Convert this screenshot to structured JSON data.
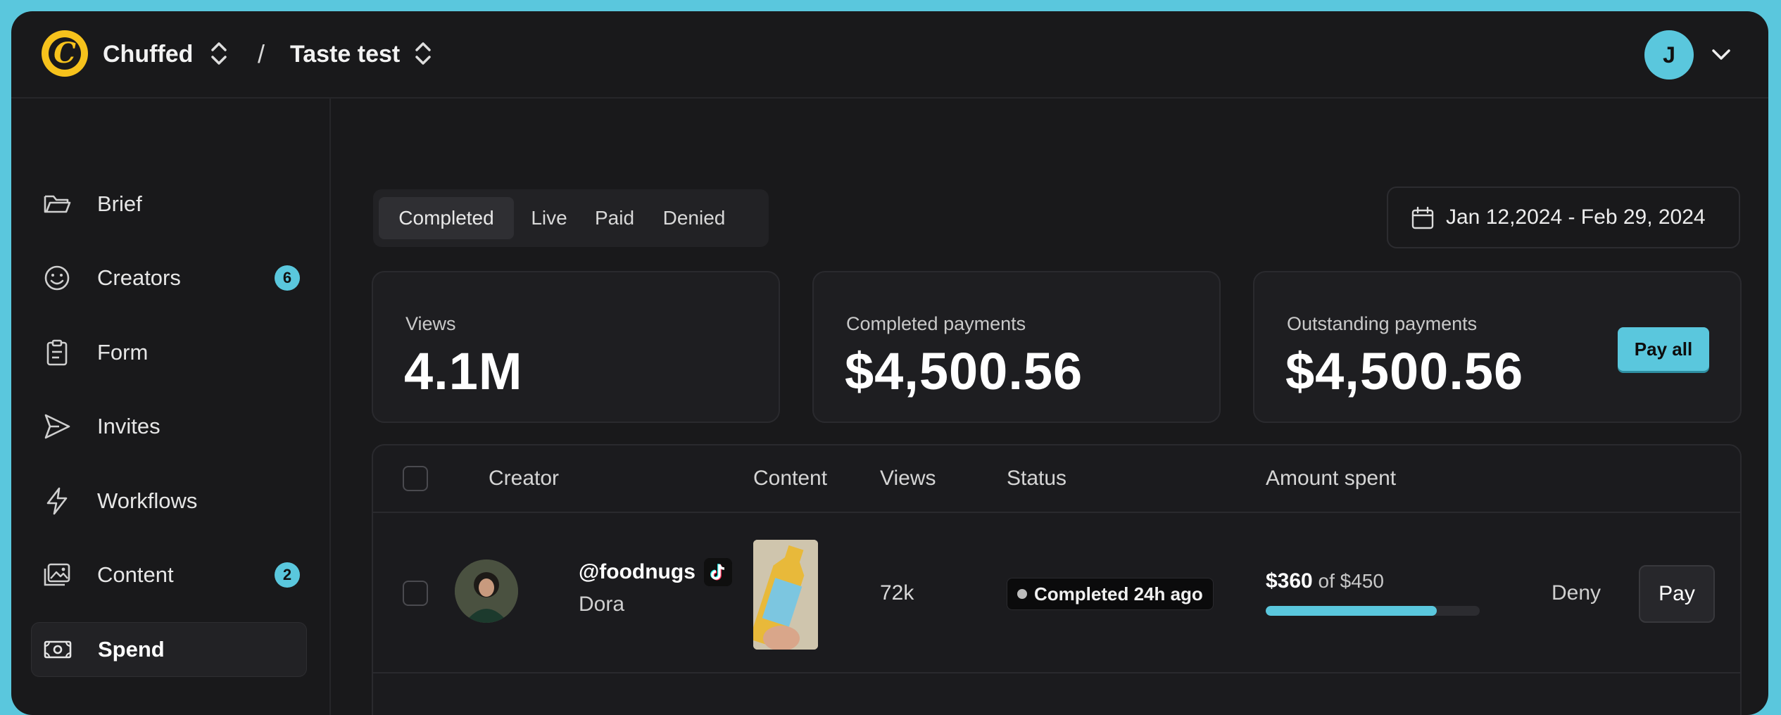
{
  "topbar": {
    "workspace": "Chuffed",
    "separator": "/",
    "project": "Taste test",
    "avatar_initial": "J"
  },
  "sidebar": {
    "items": [
      {
        "label": "Brief",
        "icon": "folder-icon"
      },
      {
        "label": "Creators",
        "icon": "smiley-icon",
        "badge": "6"
      },
      {
        "label": "Form",
        "icon": "clipboard-icon"
      },
      {
        "label": "Invites",
        "icon": "send-icon"
      },
      {
        "label": "Workflows",
        "icon": "lightning-icon"
      },
      {
        "label": "Content",
        "icon": "images-icon",
        "badge": "2"
      },
      {
        "label": "Spend",
        "icon": "money-icon",
        "active": true
      }
    ]
  },
  "filters": {
    "tabs": [
      "Completed",
      "Live",
      "Paid",
      "Denied"
    ],
    "active_tab": "Completed",
    "date_range": "Jan 12,2024 - Feb 29, 2024"
  },
  "stats": {
    "views": {
      "label": "Views",
      "value": "4.1M"
    },
    "completed": {
      "label": "Completed payments",
      "value": "$4,500.56"
    },
    "outstanding": {
      "label": "Outstanding payments",
      "value": "$4,500.56",
      "action": "Pay all"
    }
  },
  "table": {
    "headers": [
      "Creator",
      "Content",
      "Views",
      "Status",
      "Amount spent"
    ],
    "rows": [
      {
        "handle": "@foodnugs",
        "name": "Dora",
        "platform": "tiktok-icon",
        "views": "72k",
        "status": "Completed 24h ago",
        "amount": "$360",
        "amount_of": "of $450",
        "progress": 0.8,
        "deny": "Deny",
        "pay": "Pay"
      }
    ]
  },
  "colors": {
    "accent": "#5ac7dd",
    "background": "#19191b",
    "logo": "#f6c21c"
  }
}
